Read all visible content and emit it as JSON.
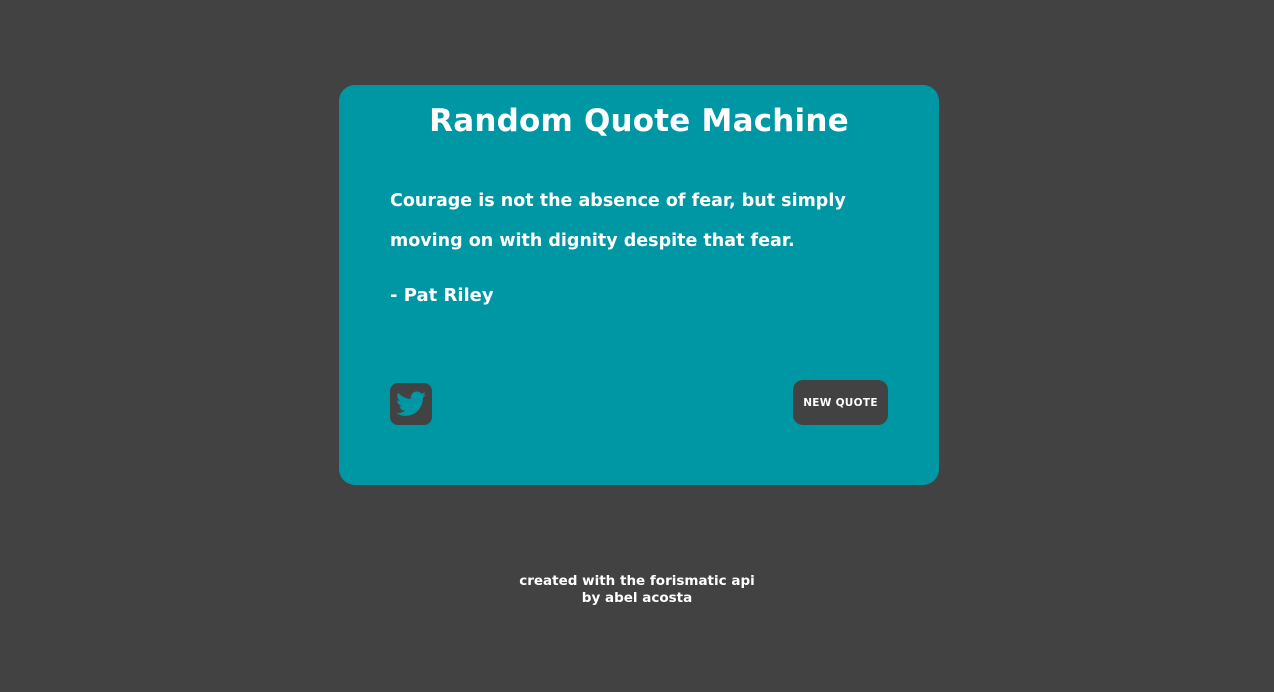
{
  "app": {
    "title": "Random Quote Machine"
  },
  "quote": {
    "text": "Courage is not the absence of fear, but simply moving on with dignity despite that fear.",
    "author": "- Pat Riley"
  },
  "actions": {
    "tweet_icon": "twitter-icon",
    "new_quote_label": "New Quote"
  },
  "footer": {
    "line1": "created with the forismatic api",
    "line2": "by abel acosta"
  },
  "colors": {
    "background": "#424242",
    "card": "#0097a5",
    "button": "#424242",
    "text": "#ffffff"
  }
}
